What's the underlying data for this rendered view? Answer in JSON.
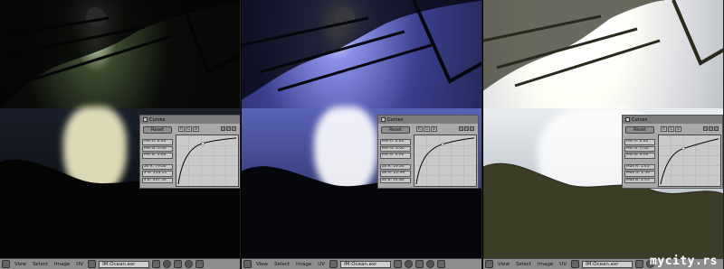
{
  "panels": [
    {
      "curves": {
        "title": "Curves",
        "reset_label": "Reset",
        "channels": [
          "R",
          "G",
          "B"
        ],
        "min_fields": [
          "Min R: 0.00",
          "Min G: 0.00",
          "Min B: 0.00"
        ],
        "max_fields": [
          "ax R: 79.00",
          "x G: 114.15",
          "x B: 147.56"
        ]
      },
      "toolbar": {
        "menus": [
          "View",
          "Select",
          "Image",
          "UV"
        ],
        "image_name": "IM:Ocean.exr"
      }
    },
    {
      "curves": {
        "title": "Curves",
        "reset_label": "Reset",
        "channels": [
          "R",
          "G",
          "B"
        ],
        "min_fields": [
          "Min R: 0.00",
          "Min G: 0.00",
          "Min B: 0.00"
        ],
        "max_fields": [
          "ax R: 19.30",
          "ax G: 22.39",
          "ax B: 14.86"
        ]
      },
      "toolbar": {
        "menus": [
          "View",
          "Select",
          "Image",
          "UV"
        ],
        "image_name": "IM:Ocean.exr"
      }
    },
    {
      "curves": {
        "title": "Curves",
        "reset_label": "Reset",
        "channels": [
          "R",
          "G",
          "B"
        ],
        "min_fields": [
          "Min R: 0.00",
          "Min G: 0.00",
          "Min B: 0.00"
        ],
        "max_fields": [
          "Max R: 1.43",
          "Max G: 1.50",
          "Max B: 2.45"
        ]
      },
      "toolbar": {
        "menus": [
          "View",
          "Select",
          "Image",
          "UV"
        ],
        "image_name": "IM:Ocean.exr"
      }
    }
  ],
  "watermark": "mycity.rs"
}
